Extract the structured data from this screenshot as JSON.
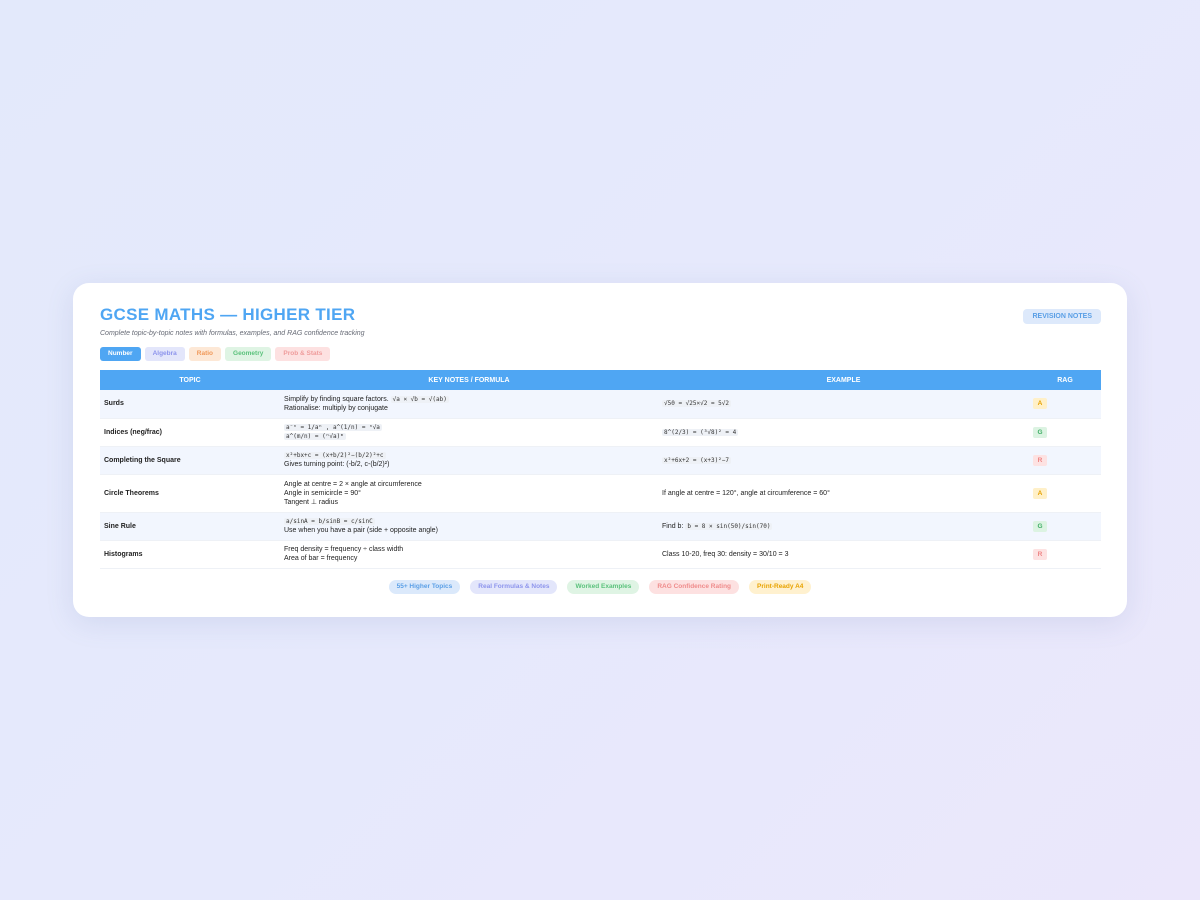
{
  "header": {
    "title": "GCSE MATHS — HIGHER TIER",
    "subtitle": "Complete topic-by-topic notes with formulas, examples, and RAG confidence tracking",
    "badge": "REVISION NOTES"
  },
  "tabs": [
    {
      "label": "Number",
      "active": true
    },
    {
      "label": "Algebra",
      "active": false
    },
    {
      "label": "Ratio",
      "active": false
    },
    {
      "label": "Geometry",
      "active": false
    },
    {
      "label": "Prob & Stats",
      "active": false
    }
  ],
  "table": {
    "columns": [
      "TOPIC",
      "KEY NOTES / FORMULA",
      "EXAMPLE",
      "RAG"
    ],
    "rows": [
      {
        "topic": "Surds",
        "notes": [
          {
            "text": "Simplify by finding square factors.",
            "code": "√a × √b = √(ab)"
          },
          {
            "text": "Rationalise: multiply by conjugate",
            "code": ""
          }
        ],
        "example": {
          "text": "",
          "code": "√50 = √25×√2 = 5√2"
        },
        "rag": "A"
      },
      {
        "topic": "Indices (neg/frac)",
        "notes": [
          {
            "text": "",
            "code": "a⁻ⁿ = 1/aⁿ , a^(1/n) = ⁿ√a"
          },
          {
            "text": "",
            "code": "a^(m/n) = (ⁿ√a)ᵐ"
          }
        ],
        "example": {
          "text": "",
          "code": "8^(2/3) = (³√8)² = 4"
        },
        "rag": "G"
      },
      {
        "topic": "Completing the Square",
        "notes": [
          {
            "text": "",
            "code": "x²+bx+c = (x+b/2)²−(b/2)²+c"
          },
          {
            "text": "Gives turning point: (-b/2, c-(b/2)²)",
            "code": ""
          }
        ],
        "example": {
          "text": "",
          "code": "x²+6x+2 = (x+3)²−7"
        },
        "rag": "R"
      },
      {
        "topic": "Circle Theorems",
        "notes": [
          {
            "text": "Angle at centre = 2 × angle at circumference",
            "code": ""
          },
          {
            "text": "Angle in semicircle = 90°",
            "code": ""
          },
          {
            "text": "Tangent ⊥ radius",
            "code": ""
          }
        ],
        "example": {
          "text": "If angle at centre = 120°, angle at circumference = 60°",
          "code": ""
        },
        "rag": "A"
      },
      {
        "topic": "Sine Rule",
        "notes": [
          {
            "text": "",
            "code": "a/sinA = b/sinB = c/sinC"
          },
          {
            "text": "Use when you have a pair (side + opposite angle)",
            "code": ""
          }
        ],
        "example": {
          "text": "Find b:",
          "code": "b = 8 × sin(50)/sin(70)"
        },
        "rag": "G"
      },
      {
        "topic": "Histograms",
        "notes": [
          {
            "text": "Freq density = frequency ÷ class width",
            "code": ""
          },
          {
            "text": "Area of bar = frequency",
            "code": ""
          }
        ],
        "example": {
          "text": "Class 10-20, freq 30: density = 30/10 = 3",
          "code": ""
        },
        "rag": "R"
      }
    ]
  },
  "features": [
    "55+ Higher Topics",
    "Real Formulas & Notes",
    "Worked Examples",
    "RAG Confidence Rating",
    "Print-Ready A4"
  ],
  "colors": {
    "accent": "#4fa6f3",
    "rag_amber": "#e5a000",
    "rag_green": "#3fae65",
    "rag_red": "#ee8585"
  }
}
